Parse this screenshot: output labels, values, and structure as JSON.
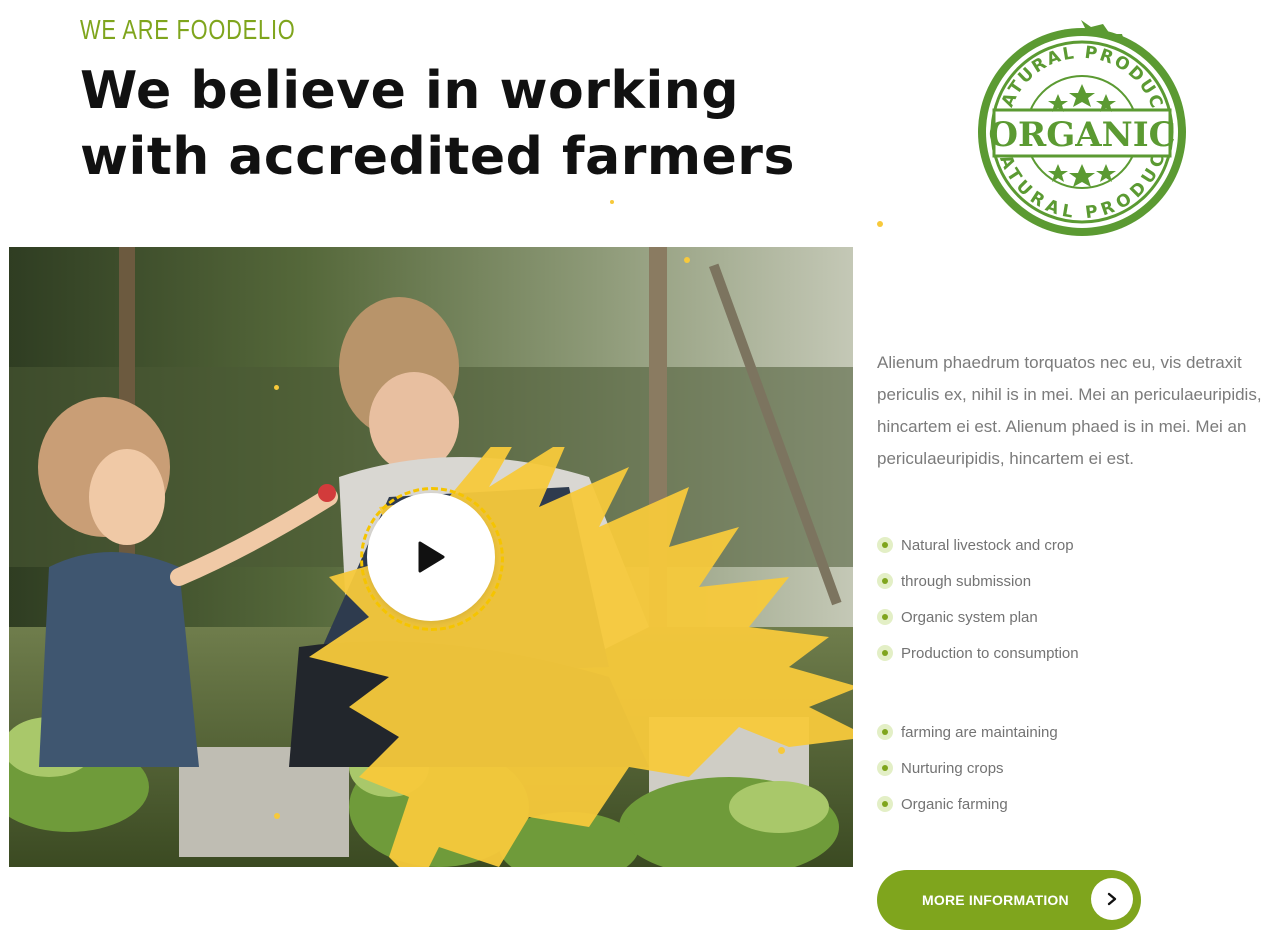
{
  "section": {
    "eyebrow": "WE ARE FOODELIO",
    "headline": "We believe in working with accredited farmers"
  },
  "stamp": {
    "top_text": "NATURAL PRODUCT",
    "center_text": "ORGANIC",
    "bottom_text": "NATURAL PRODUCT",
    "color": "#5b9a32"
  },
  "video": {
    "play_icon": "play-icon"
  },
  "intro": {
    "text": "Alienum phaedrum torquatos nec eu, vis detraxit periculis ex, nihil is in mei. Mei an periculaeuripidis, hincartem ei est. Alienum phaed is in mei. Mei an periculaeuripidis, hincartem ei est."
  },
  "features_primary": [
    "Natural livestock and crop",
    "through submission",
    "Organic system plan",
    "Production to consumption"
  ],
  "features_secondary": [
    "farming are maintaining",
    "Nurturing crops",
    "Organic farming"
  ],
  "cta": {
    "label": "MORE INFORMATION",
    "icon": "chevron-right-icon"
  },
  "colors": {
    "accent": "#7fa51d",
    "splash": "#f7c93b",
    "body_text": "#7b7b7b",
    "heading": "#111111"
  }
}
